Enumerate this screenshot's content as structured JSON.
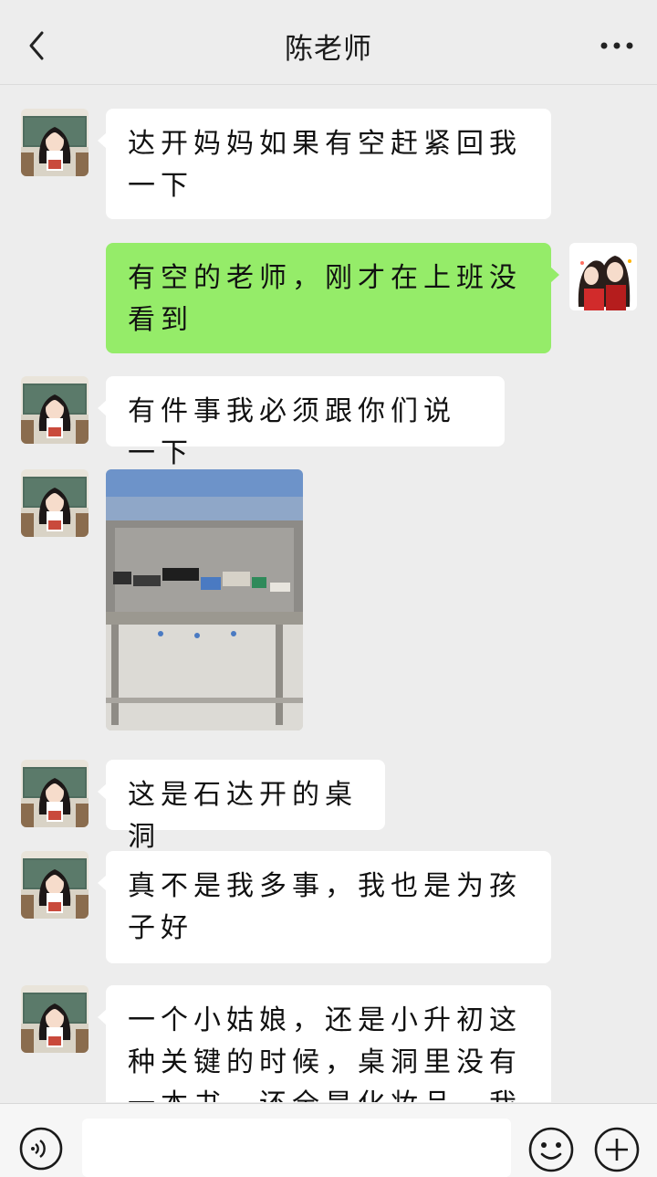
{
  "header": {
    "title": "陈老师",
    "back_icon": "chevron-left-icon",
    "more_icon": "ellipsis-icon"
  },
  "messages": [
    {
      "from": "teacher",
      "type": "text",
      "text": "达开妈妈如果有空赶紧回我一下"
    },
    {
      "from": "me",
      "type": "text",
      "text": "有空的老师，刚才在上班没看到"
    },
    {
      "from": "teacher",
      "type": "text",
      "text": "有件事我必须跟你们说一下"
    },
    {
      "from": "teacher",
      "type": "image",
      "description_icon": "photo-desk-icon"
    },
    {
      "from": "teacher",
      "type": "text",
      "text": "这是石达开的桌洞"
    },
    {
      "from": "teacher",
      "type": "text",
      "text": "真不是我多事，我也是为孩子好"
    },
    {
      "from": "teacher",
      "type": "text",
      "text": "一个小姑娘，还是小升初这种关键的时候，桌洞里没有一本书，还全是化妆品，我觉得有"
    }
  ],
  "inputbar": {
    "voice_icon": "voice-icon",
    "emoji_icon": "emoji-icon",
    "plus_icon": "plus-icon",
    "input_value": ""
  },
  "colors": {
    "background": "#ededed",
    "my_bubble": "#95ec69",
    "their_bubble": "#ffffff"
  }
}
